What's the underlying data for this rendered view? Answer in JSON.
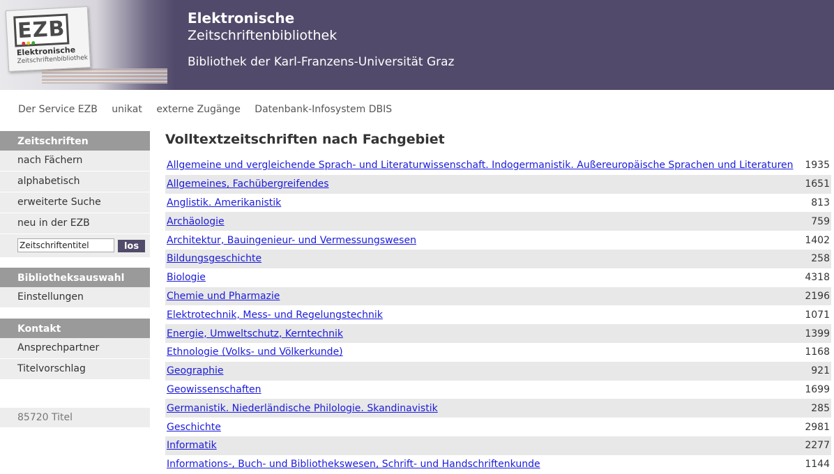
{
  "header": {
    "title_line1": "Elektronische",
    "title_line2": "Zeitschriftenbibliothek",
    "subtitle": "Bibliothek der Karl-Franzens-Universität Graz",
    "logo_main": "EZB",
    "logo_text1": "Elektronische",
    "logo_text2": "Zeitschriftenbibliothek"
  },
  "topnav": [
    "Der Service EZB",
    "unikat",
    "externe Zugänge",
    "Datenbank-Infosystem DBIS"
  ],
  "sidebar": {
    "journals_heading": "Zeitschriften",
    "journals_items": [
      "nach Fächern",
      "alphabetisch",
      "erweiterte Suche",
      "neu in der EZB"
    ],
    "search_value": "Zeitschriftentitel",
    "search_button": "los",
    "library_heading": "Bibliotheksauswahl",
    "library_items": [
      "Einstellungen"
    ],
    "contact_heading": "Kontakt",
    "contact_items": [
      "Ansprechpartner",
      "Titelvorschlag"
    ],
    "count": "85720 Titel"
  },
  "main": {
    "title": "Volltextzeitschriften nach Fachgebiet",
    "subjects": [
      {
        "name": "Allgemeine und vergleichende Sprach- und Literaturwissenschaft. Indogermanistik. Außereuropäische Sprachen und Literaturen",
        "count": "1935"
      },
      {
        "name": "Allgemeines, Fachübergreifendes",
        "count": "1651"
      },
      {
        "name": "Anglistik. Amerikanistik",
        "count": "813"
      },
      {
        "name": "Archäologie",
        "count": "759"
      },
      {
        "name": "Architektur, Bauingenieur- und Vermessungswesen",
        "count": "1402"
      },
      {
        "name": "Bildungsgeschichte",
        "count": "258"
      },
      {
        "name": "Biologie",
        "count": "4318"
      },
      {
        "name": "Chemie und Pharmazie",
        "count": "2196"
      },
      {
        "name": "Elektrotechnik, Mess- und Regelungstechnik",
        "count": "1071"
      },
      {
        "name": "Energie, Umweltschutz, Kerntechnik",
        "count": "1399"
      },
      {
        "name": "Ethnologie (Volks- und Völkerkunde)",
        "count": "1168"
      },
      {
        "name": "Geographie",
        "count": "921"
      },
      {
        "name": "Geowissenschaften",
        "count": "1699"
      },
      {
        "name": "Germanistik. Niederländische Philologie. Skandinavistik",
        "count": "285"
      },
      {
        "name": "Geschichte",
        "count": "2981"
      },
      {
        "name": "Informatik",
        "count": "2277"
      },
      {
        "name": "Informations-, Buch- und Bibliothekswesen, Schrift- und Handschriftenkunde",
        "count": "1144"
      }
    ]
  },
  "colors": {
    "header_bg": "#524a6a",
    "link": "#1a1adb",
    "sidebar_head": "#9a9a9a"
  }
}
